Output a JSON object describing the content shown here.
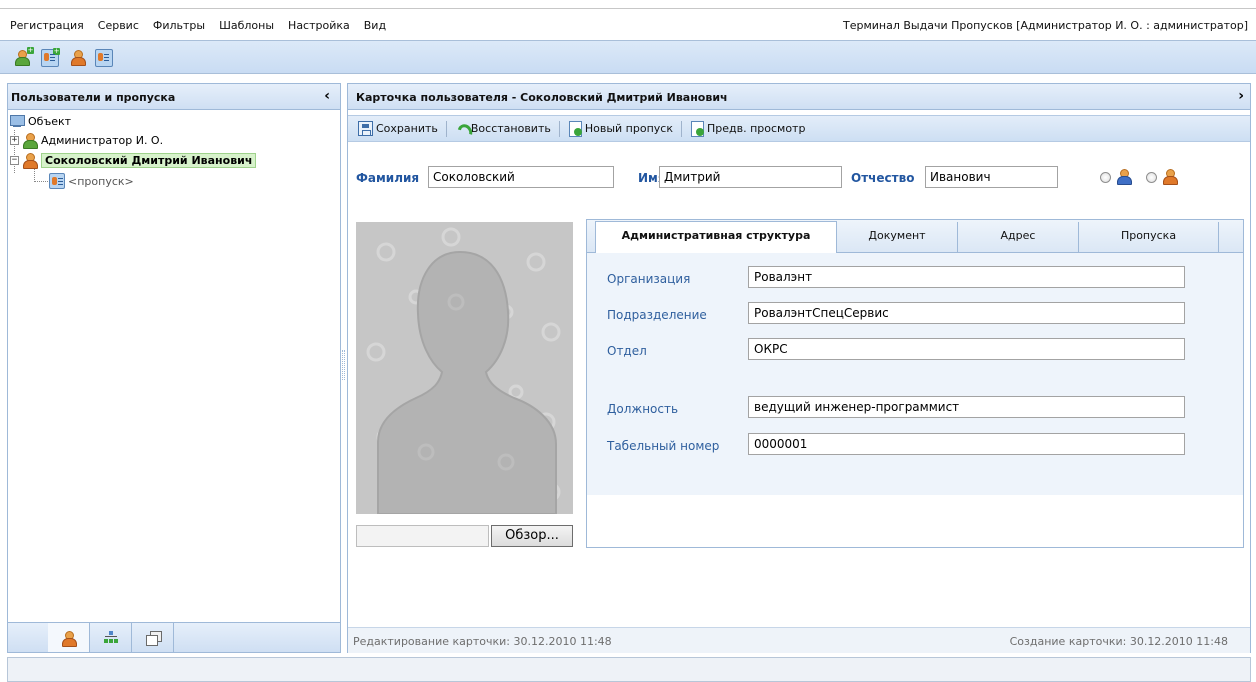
{
  "menu": {
    "items": [
      "Регистрация",
      "Сервис",
      "Фильтры",
      "Шаблоны",
      "Настройка",
      "Вид"
    ],
    "app_title": "Терминал Выдачи Пропусков [Администратор И. О. : администратор]"
  },
  "main_toolbar": {
    "icons": [
      "add-user-icon",
      "add-card-icon",
      "user-icon",
      "card-list-icon"
    ]
  },
  "left_panel": {
    "title": "Пользователи и пропуска",
    "tree": {
      "root": "Объект",
      "nodes": [
        {
          "label": "Администратор И. О.",
          "expander": "+",
          "selected": false
        },
        {
          "label": "Соколовский Дмитрий Иванович",
          "expander": "−",
          "selected": true,
          "children": [
            "<пропуск>"
          ]
        }
      ]
    },
    "bottom_tabs": [
      "users-icon",
      "structure-icon",
      "windows-icon"
    ]
  },
  "card": {
    "title": "Карточка пользователя - Соколовский Дмитрий Иванович",
    "toolbar": {
      "save": "Сохранить",
      "restore": "Восстановить",
      "new_pass": "Новый пропуск",
      "preview": "Предв. просмотр"
    },
    "surname_label": "Фамилия",
    "surname": "Соколовский",
    "name_label": "Имя",
    "name": "Дмитрий",
    "patronymic_label": "Отчество",
    "patronymic": "Иванович",
    "browse_label": "Обзор...",
    "tabs": [
      "Административная структура",
      "Документ",
      "Адрес",
      "Пропуска"
    ],
    "active_tab": "Административная структура",
    "fields": [
      {
        "label": "Организация",
        "value": "Ровалэнт"
      },
      {
        "label": "Подразделение",
        "value": "РовалэнтСпецСервис"
      },
      {
        "label": "Отдел",
        "value": "ОКРС"
      },
      {
        "label": "Должность",
        "value": "ведущий инженер-программист"
      },
      {
        "label": "Табельный номер",
        "value": "0000001"
      }
    ],
    "status_edited": "Редактирование карточки: 30.12.2010 11:48",
    "status_created": "Создание карточки: 30.12.2010 11:48"
  }
}
